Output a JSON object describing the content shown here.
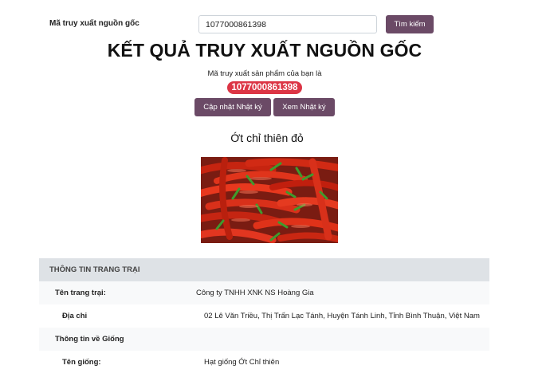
{
  "search": {
    "label": "Mã truy xuất nguồn gốc",
    "value": "1077000861398",
    "button_label": "Tìm kiếm"
  },
  "result": {
    "title": "KẾT QUẢ TRUY XUẤT NGUỒN GỐC",
    "caption": "Mã truy xuất sản phẩm của bạn là",
    "code": "1077000861398",
    "update_log_label": "Cập nhật Nhật ký",
    "view_log_label": "Xem Nhật ký"
  },
  "product": {
    "name": "Ớt chỉ thiên đỏ"
  },
  "farm_info": {
    "header": "THÔNG TIN TRANG TRẠI",
    "rows": [
      {
        "label": "Tên trang trại:",
        "value": "Công ty TNHH XNK NS Hoàng Gia"
      },
      {
        "label": "Địa chỉ",
        "value": "02 Lê Văn Triều, Thị Trấn Lạc Tánh, Huyện Tánh Linh, Tỉnh Bình Thuận, Việt Nam"
      },
      {
        "label": "Thông tin về Giống",
        "value": ""
      },
      {
        "label": "Tên giống:",
        "value": "Hạt giống Ớt Chỉ thiên"
      }
    ]
  },
  "colors": {
    "button_bg": "#6b4a66",
    "badge_bg": "#dc3545",
    "table_header_bg": "#dee2e6",
    "stripe_bg": "#f8f9fa"
  }
}
